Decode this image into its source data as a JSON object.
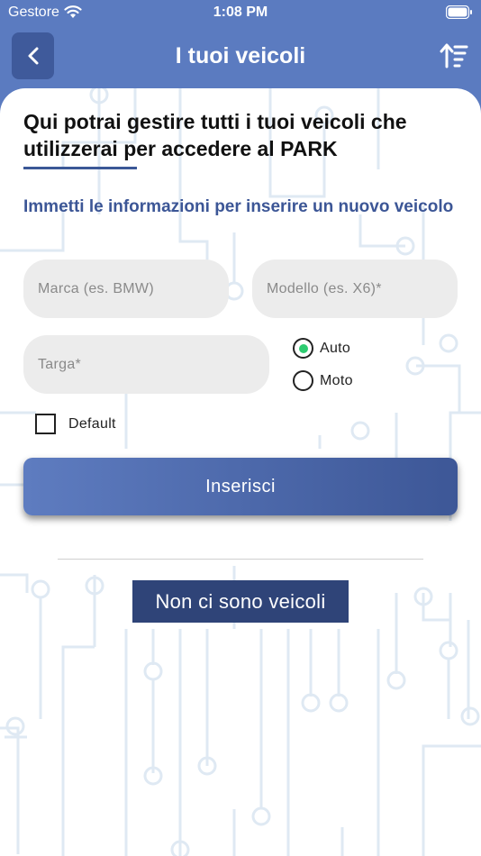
{
  "status_bar": {
    "carrier": "Gestore",
    "time": "1:08 PM"
  },
  "nav": {
    "title": "I tuoi veicoli"
  },
  "intro": {
    "heading": "Qui potrai gestire tutti i tuoi veicoli che utilizzerai per accedere al PARK",
    "subtitle": "Immetti le informazioni per inserire un nuovo veicolo"
  },
  "form": {
    "marca_placeholder": "Marca (es. BMW)",
    "modello_placeholder": "Modello (es. X6)*",
    "targa_placeholder": "Targa*",
    "vehicle_types": [
      {
        "label": "Auto",
        "selected": true
      },
      {
        "label": "Moto",
        "selected": false
      }
    ],
    "default_label": "Default",
    "default_checked": false,
    "submit_label": "Inserisci"
  },
  "list": {
    "empty_message": "Non ci sono veicoli"
  },
  "colors": {
    "header": "#5b7bc0",
    "back_button": "#3f5a9b",
    "accent": "#3c5696",
    "radio_selected": "#2ecc71",
    "empty_badge": "#2f4478"
  }
}
